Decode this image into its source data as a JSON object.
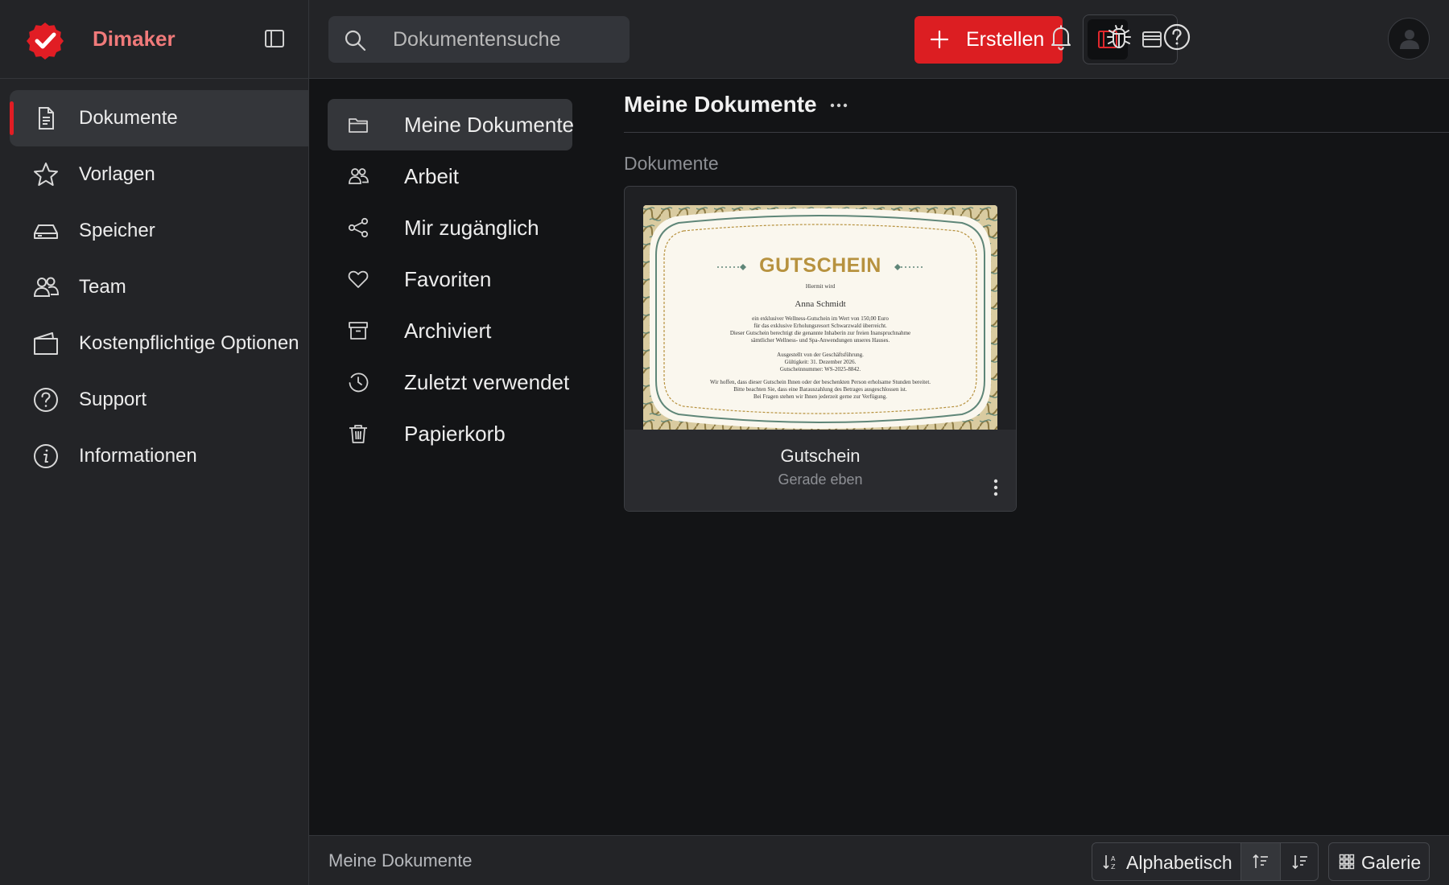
{
  "brand": {
    "name": "Dimaker",
    "logo_color": "#e11d24",
    "name_color": "#f07a7a"
  },
  "sidebar": {
    "items": [
      {
        "label": "Dokumente",
        "icon": "document-icon",
        "active": true
      },
      {
        "label": "Vorlagen",
        "icon": "star-icon"
      },
      {
        "label": "Speicher",
        "icon": "storage-icon"
      },
      {
        "label": "Team",
        "icon": "team-icon"
      },
      {
        "label": "Kostenpflichtige Optionen",
        "icon": "wallet-icon"
      },
      {
        "label": "Support",
        "icon": "help-circle-icon"
      },
      {
        "label": "Informationen",
        "icon": "info-icon"
      }
    ]
  },
  "topbar": {
    "search_placeholder": "Dokumentensuche",
    "create_label": "Erstellen",
    "accent": "#dc1e22"
  },
  "folders": {
    "items": [
      {
        "label": "Meine Dokumente",
        "icon": "folder-icon",
        "active": true
      },
      {
        "label": "Arbeit",
        "icon": "group-icon"
      },
      {
        "label": "Mir zugänglich",
        "icon": "share-icon"
      },
      {
        "label": "Favoriten",
        "icon": "heart-icon"
      },
      {
        "label": "Archiviert",
        "icon": "archive-icon"
      },
      {
        "label": "Zuletzt verwendet",
        "icon": "clock-icon"
      },
      {
        "label": "Papierkorb",
        "icon": "trash-icon"
      }
    ]
  },
  "main": {
    "title": "Meine Dokumente",
    "section_label": "Dokumente",
    "documents": [
      {
        "name": "Gutschein",
        "modified": "Gerade eben",
        "preview": {
          "title": "GUTSCHEIN",
          "hiermit": "Hiermit wird",
          "recipient": "Anna Schmidt",
          "body": [
            "ein exklusiver Wellness-Gutschein im Wert von 150,00 Euro",
            "für das exklusive Erholungsresort Schwarzwald überreicht.",
            "Dieser Gutschein berechtigt die genannte Inhaberin zur freien Inanspruchnahme",
            "sämtlicher Wellness- und Spa-Anwendungen unseres Hauses."
          ],
          "details": [
            "Ausgestellt von der Geschäftsführung.",
            "Gültigkeit: 31. Dezember 2026.",
            "Gutscheinnummer: WS-2025-8842."
          ],
          "footer": [
            "Wir hoffen, dass dieser Gutschein Ihnen oder der beschenkten Person erholsame Stunden bereitet.",
            "Bitte beachten Sie, dass eine Barauszahlung des Betrages ausgeschlossen ist.",
            "Bei Fragen stehen wir Ihnen jederzeit gerne zur Verfügung."
          ]
        }
      }
    ]
  },
  "bottombar": {
    "breadcrumb": "Meine Dokumente",
    "sort_label": "Alphabetisch",
    "view_label": "Galerie"
  }
}
